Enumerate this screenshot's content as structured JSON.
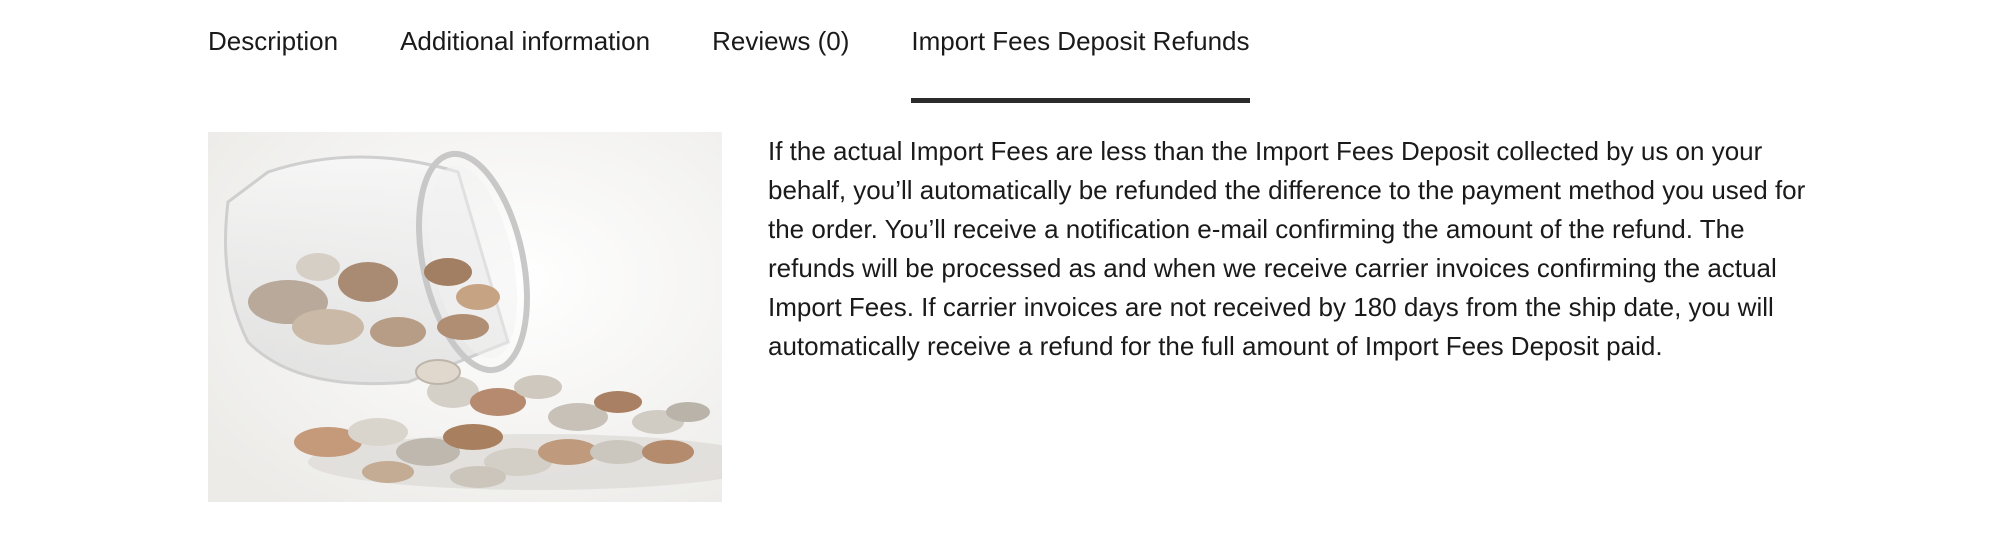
{
  "tabs": [
    {
      "label": "Description",
      "active": false
    },
    {
      "label": "Additional information",
      "active": false
    },
    {
      "label": "Reviews (0)",
      "active": false
    },
    {
      "label": "Import Fees Deposit Refunds",
      "active": true
    }
  ],
  "panel": {
    "image_icon": "coin-jar-icon",
    "text": "If the actual Import Fees are less than the Import Fees Deposit collected by us on your behalf, you’ll automatically be refunded the difference to the payment method you used for the order. You’ll receive a notification e-mail confirming the amount of the refund. The refunds will be processed as and when we receive carrier invoices confirming the actual Import Fees. If carrier invoices are not received by 180 days from the ship date, you will automatically receive a refund for the full amount of Import Fees Deposit paid."
  },
  "colors": {
    "active_underline": "#2b2b2b",
    "text": "#1a1a1a",
    "background": "#ffffff"
  }
}
